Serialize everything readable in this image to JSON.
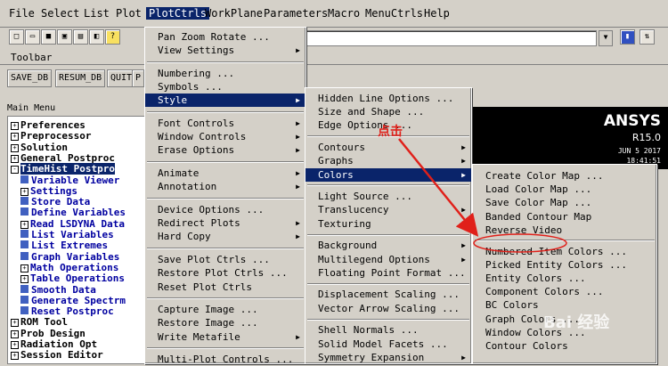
{
  "menubar": [
    "File",
    "Select",
    "List",
    "Plot",
    "PlotCtrls",
    "WorkPlane",
    "Parameters",
    "Macro",
    "MenuCtrls",
    "Help"
  ],
  "toolbar": {
    "label": "Toolbar",
    "buttons": [
      "SAVE_DB",
      "RESUM_DB",
      "QUIT",
      "P"
    ]
  },
  "main_menu": {
    "title": "Main Menu",
    "items": [
      {
        "label": "Preferences",
        "kind": "box",
        "sym": "⊟"
      },
      {
        "label": "Preprocessor",
        "kind": "box",
        "sym": "+"
      },
      {
        "label": "Solution",
        "kind": "box",
        "sym": "+"
      },
      {
        "label": "General Postproc",
        "kind": "box",
        "sym": "+"
      },
      {
        "label": "TimeHist Postpro",
        "kind": "box",
        "sym": "-"
      },
      {
        "label": "Variable Viewer",
        "kind": "sq"
      },
      {
        "label": "Settings",
        "kind": "box",
        "sym": "+"
      },
      {
        "label": "Store Data",
        "kind": "sq"
      },
      {
        "label": "Define Variables",
        "kind": "sq"
      },
      {
        "label": "Read LSDYNA Data",
        "kind": "box",
        "sym": "+"
      },
      {
        "label": "List Variables",
        "kind": "sq"
      },
      {
        "label": "List Extremes",
        "kind": "sq"
      },
      {
        "label": "Graph Variables",
        "kind": "sq"
      },
      {
        "label": "Math Operations",
        "kind": "box",
        "sym": "+"
      },
      {
        "label": "Table Operations",
        "kind": "box",
        "sym": "+"
      },
      {
        "label": "Smooth Data",
        "kind": "sq"
      },
      {
        "label": "Generate Spectrm",
        "kind": "sq"
      },
      {
        "label": "Reset Postproc",
        "kind": "sq"
      },
      {
        "label": "ROM Tool",
        "kind": "box",
        "sym": "+"
      },
      {
        "label": "Prob Design",
        "kind": "box",
        "sym": "+"
      },
      {
        "label": "Radiation Opt",
        "kind": "box",
        "sym": "+"
      },
      {
        "label": "Session Editor",
        "kind": "box",
        "sym": "+"
      }
    ]
  },
  "plotctrls_menu": [
    {
      "label": "Pan Zoom Rotate ...",
      "sub": false
    },
    {
      "label": "View Settings",
      "sub": true
    },
    {
      "sep": true
    },
    {
      "label": "Numbering ...",
      "sub": false
    },
    {
      "label": "Symbols ...",
      "sub": false
    },
    {
      "label": "Style",
      "sub": true,
      "hl": true
    },
    {
      "sep": true
    },
    {
      "label": "Font Controls",
      "sub": true
    },
    {
      "label": "Window Controls",
      "sub": true
    },
    {
      "label": "Erase Options",
      "sub": true
    },
    {
      "sep": true
    },
    {
      "label": "Animate",
      "sub": true
    },
    {
      "label": "Annotation",
      "sub": true
    },
    {
      "sep": true
    },
    {
      "label": "Device Options ...",
      "sub": false
    },
    {
      "label": "Redirect Plots",
      "sub": true
    },
    {
      "label": "Hard Copy",
      "sub": true
    },
    {
      "sep": true
    },
    {
      "label": "Save Plot Ctrls ...",
      "sub": false
    },
    {
      "label": "Restore Plot Ctrls ...",
      "sub": false
    },
    {
      "label": "Reset Plot Ctrls",
      "sub": false
    },
    {
      "sep": true
    },
    {
      "label": "Capture Image ...",
      "sub": false
    },
    {
      "label": "Restore Image ...",
      "sub": false
    },
    {
      "label": "Write Metafile",
      "sub": true
    },
    {
      "sep": true
    },
    {
      "label": "Multi-Plot Controls ...",
      "sub": false
    }
  ],
  "style_menu": [
    {
      "label": "Hidden Line Options ...",
      "sub": false
    },
    {
      "label": "Size and Shape ...",
      "sub": false
    },
    {
      "label": "Edge Options ...",
      "sub": false
    },
    {
      "sep": true
    },
    {
      "label": "Contours",
      "sub": true
    },
    {
      "label": "Graphs",
      "sub": true
    },
    {
      "label": "Colors",
      "sub": true,
      "hl": true
    },
    {
      "sep": true
    },
    {
      "label": "Light Source ...",
      "sub": false
    },
    {
      "label": "Translucency",
      "sub": true
    },
    {
      "label": "Texturing",
      "sub": true
    },
    {
      "sep": true
    },
    {
      "label": "Background",
      "sub": true
    },
    {
      "label": "Multilegend Options",
      "sub": true
    },
    {
      "label": "Floating Point Format ...",
      "sub": false
    },
    {
      "sep": true
    },
    {
      "label": "Displacement Scaling ...",
      "sub": false
    },
    {
      "label": "Vector Arrow Scaling ...",
      "sub": false
    },
    {
      "sep": true
    },
    {
      "label": "Shell Normals ...",
      "sub": false
    },
    {
      "label": "Solid Model Facets ...",
      "sub": false
    },
    {
      "label": "Symmetry Expansion",
      "sub": true
    }
  ],
  "colors_menu": [
    {
      "label": "Create Color Map ...",
      "sub": false
    },
    {
      "label": "Load Color Map ...",
      "sub": false
    },
    {
      "label": "Save Color Map ...",
      "sub": false
    },
    {
      "label": "Banded Contour Map",
      "sub": false
    },
    {
      "label": "Reverse Video",
      "sub": false
    },
    {
      "sep": true
    },
    {
      "label": "Numbered Item Colors ...",
      "sub": false
    },
    {
      "label": "Picked Entity Colors ...",
      "sub": false
    },
    {
      "label": "Entity Colors ...",
      "sub": false
    },
    {
      "label": "Component Colors ...",
      "sub": false
    },
    {
      "label": "BC Colors",
      "sub": false
    },
    {
      "label": "Graph Colors ...",
      "sub": false
    },
    {
      "label": "Window Colors ...",
      "sub": false
    },
    {
      "label": "Contour Colors",
      "sub": false
    }
  ],
  "graphics": {
    "logo": "ANSYS",
    "release": "R15.0",
    "date": "JUN  5 2017",
    "time": "18:41:51"
  },
  "annotation": {
    "text": "点击",
    "color": "#e0201a"
  },
  "watermark": "Bai 经验",
  "colors": {
    "highlight": "#0a246a",
    "menu_bg": "#d4d0c8",
    "tree_blue": "#0000a0"
  }
}
